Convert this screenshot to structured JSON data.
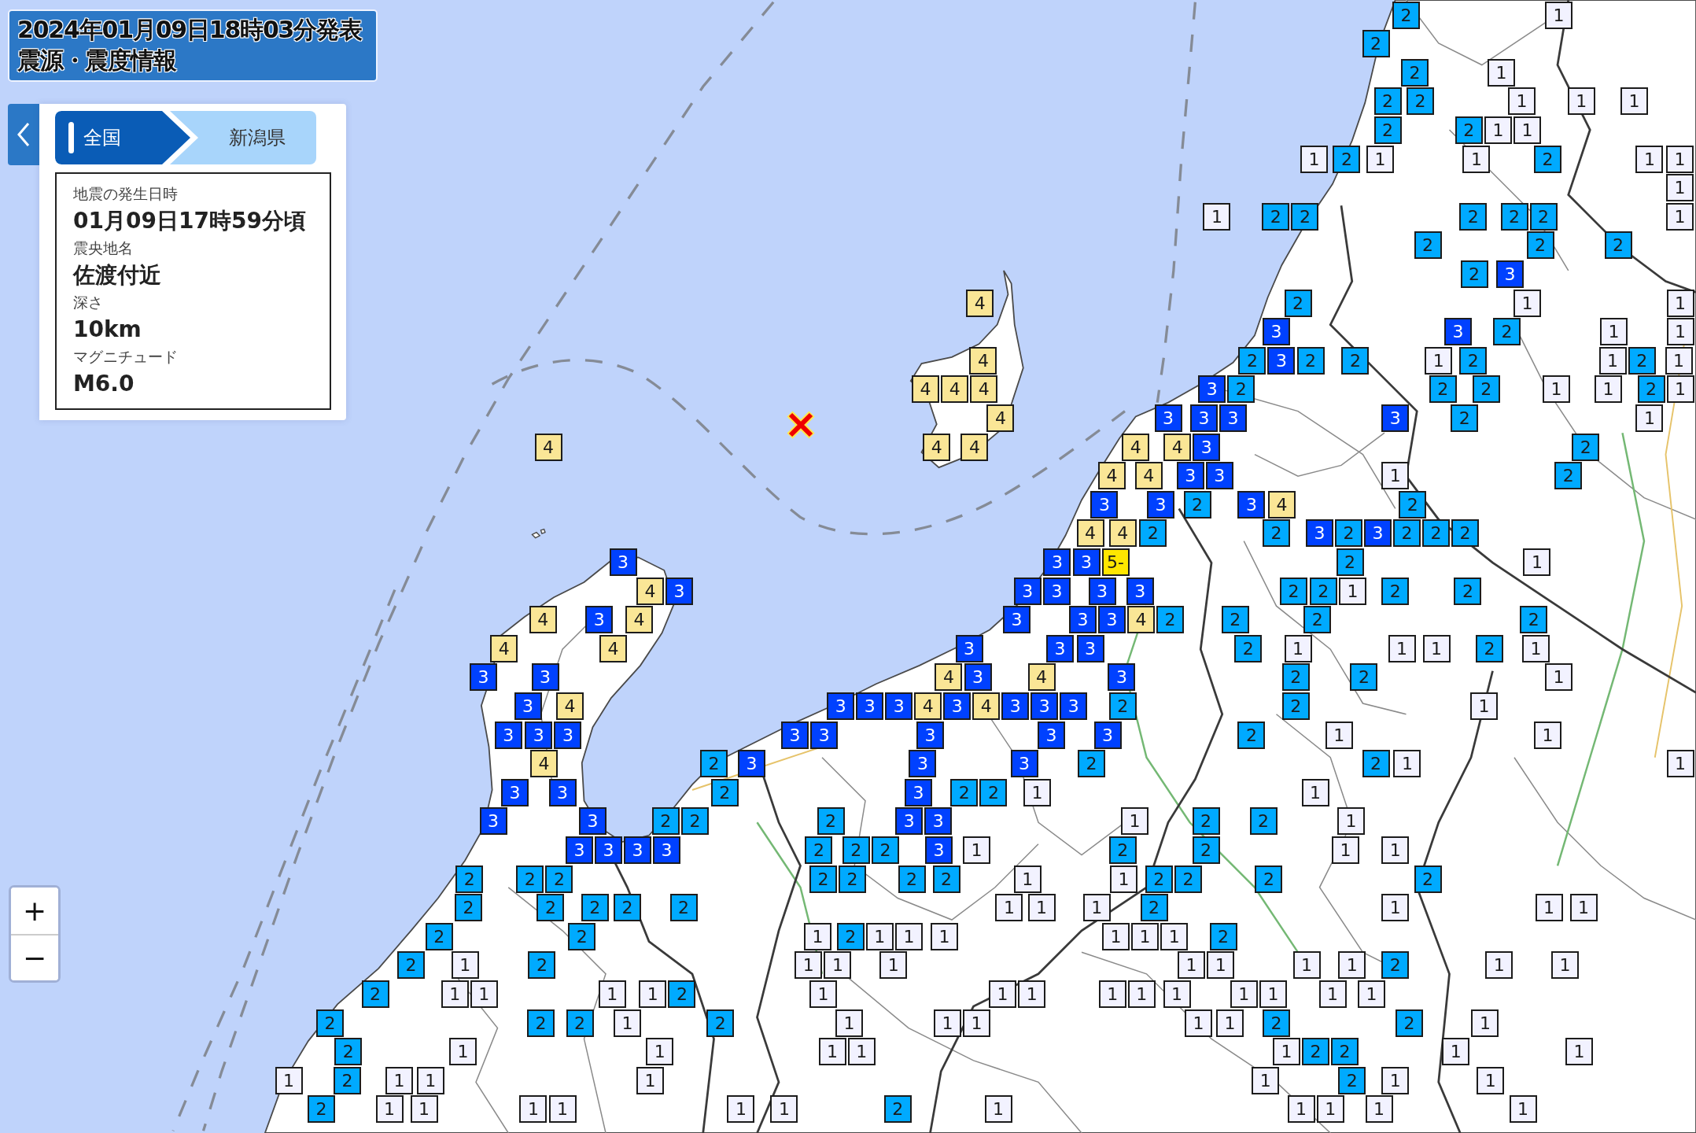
{
  "title": {
    "issued": "2024年01月09日18時03分発表",
    "heading": "震源・震度情報"
  },
  "breadcrumb": [
    {
      "label": "全国",
      "selected": true
    },
    {
      "label": "新潟県",
      "selected": false
    }
  ],
  "details": [
    {
      "label": "地震の発生日時",
      "value": "01月09日17時59分頃"
    },
    {
      "label": "震央地名",
      "value": "佐渡付近"
    },
    {
      "label": "深さ",
      "value": "10km"
    },
    {
      "label": "マグニチュード",
      "value": "M6.0"
    }
  ],
  "zoom_buttons": [
    "+",
    "−"
  ],
  "intensity_groups": [
    {
      "color": "#f2f2ff",
      "markers": [
        "1",
        "1",
        "1",
        "1",
        "1",
        "1",
        "1",
        "1",
        "1",
        "1",
        "1",
        "1",
        "1",
        "1",
        "1",
        "1",
        "1",
        "1",
        "1",
        "1",
        "1",
        "1",
        "1",
        "1",
        "1",
        "1",
        "1",
        "1",
        "1",
        "1",
        "1",
        "1",
        "1",
        "1",
        "1",
        "1",
        "1",
        "1",
        "1",
        "1",
        "1",
        "1",
        "1",
        "1",
        "1",
        "1",
        "1",
        "1",
        "1",
        "1",
        "1",
        "1",
        "1",
        "1",
        "1",
        "1",
        "1",
        "1",
        "1",
        "1",
        "1",
        "1",
        "1",
        "1",
        "1",
        "1",
        "1",
        "1",
        "1",
        "1",
        "1",
        "1",
        "1",
        "1",
        "1",
        "1",
        "1",
        "1",
        "1",
        "1",
        "1",
        "1",
        "1",
        "1",
        "1",
        "1",
        "1",
        "1",
        "1",
        "1",
        "1",
        "1",
        "1",
        "1",
        "1",
        "1",
        "1",
        "1",
        "1",
        "1",
        "1",
        "1",
        "1",
        "1",
        "1",
        "1",
        "1",
        "1",
        "1",
        "1",
        "1",
        "1",
        "1",
        "1",
        "1",
        "1",
        "1"
      ]
    },
    {
      "color": "#00aaff",
      "markers": [
        "2",
        "2",
        "2",
        "2",
        "2",
        "2",
        "2",
        "2",
        "2",
        "2",
        "2",
        "2",
        "2",
        "2",
        "2",
        "2",
        "2",
        "2",
        "2",
        "2",
        "2",
        "2",
        "2",
        "2",
        "2",
        "2",
        "2",
        "2",
        "2",
        "2",
        "2",
        "2",
        "2",
        "2",
        "2",
        "2",
        "2",
        "2",
        "2",
        "2",
        "2",
        "2",
        "2",
        "2",
        "2",
        "2",
        "2",
        "2",
        "2",
        "2",
        "2",
        "2",
        "2",
        "2",
        "2",
        "2",
        "2",
        "2",
        "2",
        "2",
        "2",
        "2",
        "2",
        "2",
        "2",
        "2",
        "2",
        "2",
        "2",
        "2",
        "2",
        "2",
        "2",
        "2",
        "2",
        "2",
        "2",
        "2",
        "2",
        "2",
        "2",
        "2",
        "2",
        "2",
        "2",
        "2",
        "2",
        "2",
        "2",
        "2",
        "2",
        "2",
        "2",
        "2",
        "2",
        "2",
        "2",
        "2",
        "2",
        "2",
        "2",
        "2",
        "2",
        "2",
        "2",
        "2",
        "2",
        "2",
        "2",
        "2",
        "2"
      ]
    },
    {
      "color": "#0041ff",
      "markers": [
        "3",
        "3",
        "3",
        "3",
        "3",
        "3",
        "3",
        "3",
        "3",
        "3",
        "3",
        "3",
        "3",
        "3",
        "3",
        "3",
        "3",
        "3",
        "3",
        "3",
        "3",
        "3",
        "3",
        "3",
        "3",
        "3",
        "3",
        "3",
        "3",
        "3",
        "3",
        "3",
        "3",
        "3",
        "3",
        "3",
        "3",
        "3",
        "3",
        "3",
        "3",
        "3",
        "3",
        "3",
        "3",
        "3",
        "3",
        "3",
        "3",
        "3",
        "3",
        "3",
        "3",
        "3",
        "3",
        "3",
        "3",
        "3",
        "3",
        "3",
        "3",
        "3",
        "3",
        "3",
        "3",
        "3",
        "3"
      ]
    },
    {
      "color": "#fae696",
      "markers": [
        "4",
        "4",
        "4",
        "4",
        "4",
        "4",
        "4",
        "4",
        "4",
        "4",
        "4",
        "4",
        "4",
        "4",
        "4",
        "4",
        "4",
        "4",
        "4",
        "4",
        "4",
        "4",
        "4",
        "4",
        "4",
        "4",
        "4",
        "4"
      ]
    },
    {
      "color": "#ffe600",
      "markers": [
        "5-"
      ]
    }
  ]
}
